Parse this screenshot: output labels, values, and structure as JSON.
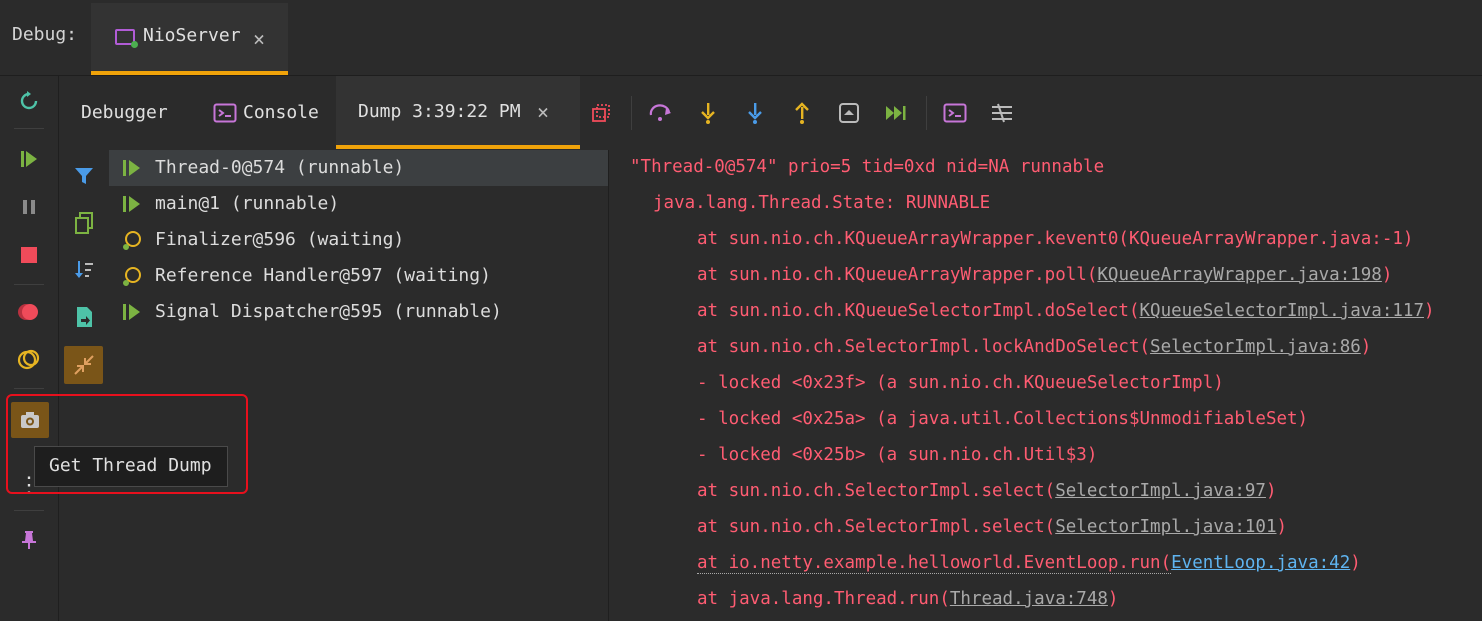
{
  "top_bar": {
    "debug_label": "Debug:",
    "session_tab": {
      "name": "NioServer",
      "close": "×",
      "icon": "run-config-icon"
    }
  },
  "tabs": {
    "debugger": "Debugger",
    "console": "Console",
    "dump": "Dump 3:39:22 PM",
    "dump_close": "×"
  },
  "toolbar_icons": [
    "restore-layout-icon",
    "step-over-icon",
    "step-into-icon",
    "force-step-into-icon",
    "step-out-icon",
    "drop-frame-icon",
    "run-to-cursor-icon",
    "evaluate-icon",
    "trace-icon"
  ],
  "left_toolbar_icons": [
    "rerun-icon",
    "resume-icon",
    "pause-icon",
    "stop-icon",
    "view-breakpoints-icon",
    "mute-breakpoints-icon",
    "camera-icon",
    "more-icon",
    "pin-icon"
  ],
  "thread_toolbar_icons": [
    "filter-icon",
    "copy-icon",
    "sort-icon",
    "export-icon",
    "merge-icon"
  ],
  "threads": [
    {
      "label": "Thread-0@574 (runnable)",
      "state": "runnable",
      "selected": true
    },
    {
      "label": "main@1 (runnable)",
      "state": "runnable",
      "selected": false
    },
    {
      "label": "Finalizer@596 (waiting)",
      "state": "waiting",
      "selected": false
    },
    {
      "label": "Reference Handler@597 (waiting)",
      "state": "waiting",
      "selected": false
    },
    {
      "label": "Signal Dispatcher@595 (runnable)",
      "state": "runnable",
      "selected": false
    }
  ],
  "dump": {
    "header": "\"Thread-0@574\" prio=5 tid=0xd nid=NA runnable",
    "state_line": "java.lang.Thread.State: RUNNABLE",
    "frames": [
      {
        "prefix": "at sun.nio.ch.KQueueArrayWrapper.kevent0(",
        "link": "KQueueArrayWrapper.java:-1",
        "suffix": ")",
        "link_style": "none"
      },
      {
        "prefix": "at sun.nio.ch.KQueueArrayWrapper.poll(",
        "link": "KQueueArrayWrapper.java:198",
        "suffix": ")",
        "link_style": "grey"
      },
      {
        "prefix": "at sun.nio.ch.KQueueSelectorImpl.doSelect(",
        "link": "KQueueSelectorImpl.java:117",
        "suffix": ")",
        "link_style": "grey"
      },
      {
        "prefix": "at sun.nio.ch.SelectorImpl.lockAndDoSelect(",
        "link": "SelectorImpl.java:86",
        "suffix": ")",
        "link_style": "grey"
      },
      {
        "prefix": "- locked <0x23f> (a sun.nio.ch.KQueueSelectorImpl)",
        "link": "",
        "suffix": "",
        "link_style": "none"
      },
      {
        "prefix": "- locked <0x25a> (a java.util.Collections$UnmodifiableSet)",
        "link": "",
        "suffix": "",
        "link_style": "none"
      },
      {
        "prefix": "- locked <0x25b> (a sun.nio.ch.Util$3)",
        "link": "",
        "suffix": "",
        "link_style": "none"
      },
      {
        "prefix": "at sun.nio.ch.SelectorImpl.select(",
        "link": "SelectorImpl.java:97",
        "suffix": ")",
        "link_style": "grey"
      },
      {
        "prefix": "at sun.nio.ch.SelectorImpl.select(",
        "link": "SelectorImpl.java:101",
        "suffix": ")",
        "link_style": "grey"
      },
      {
        "prefix": "at io.netty.example.helloworld.EventLoop.run(",
        "link": "EventLoop.java:42",
        "suffix": ")",
        "link_style": "blue"
      },
      {
        "prefix": "at java.lang.Thread.run(",
        "link": "Thread.java:748",
        "suffix": ")",
        "link_style": "grey"
      }
    ]
  },
  "tooltip": {
    "text": "Get Thread Dump"
  },
  "colors": {
    "accent": "#f0a30a",
    "dump_text": "#ff5c72",
    "highlight": "#e8101d",
    "run_green": "#7cb342",
    "wait_yellow": "#e6b422"
  }
}
